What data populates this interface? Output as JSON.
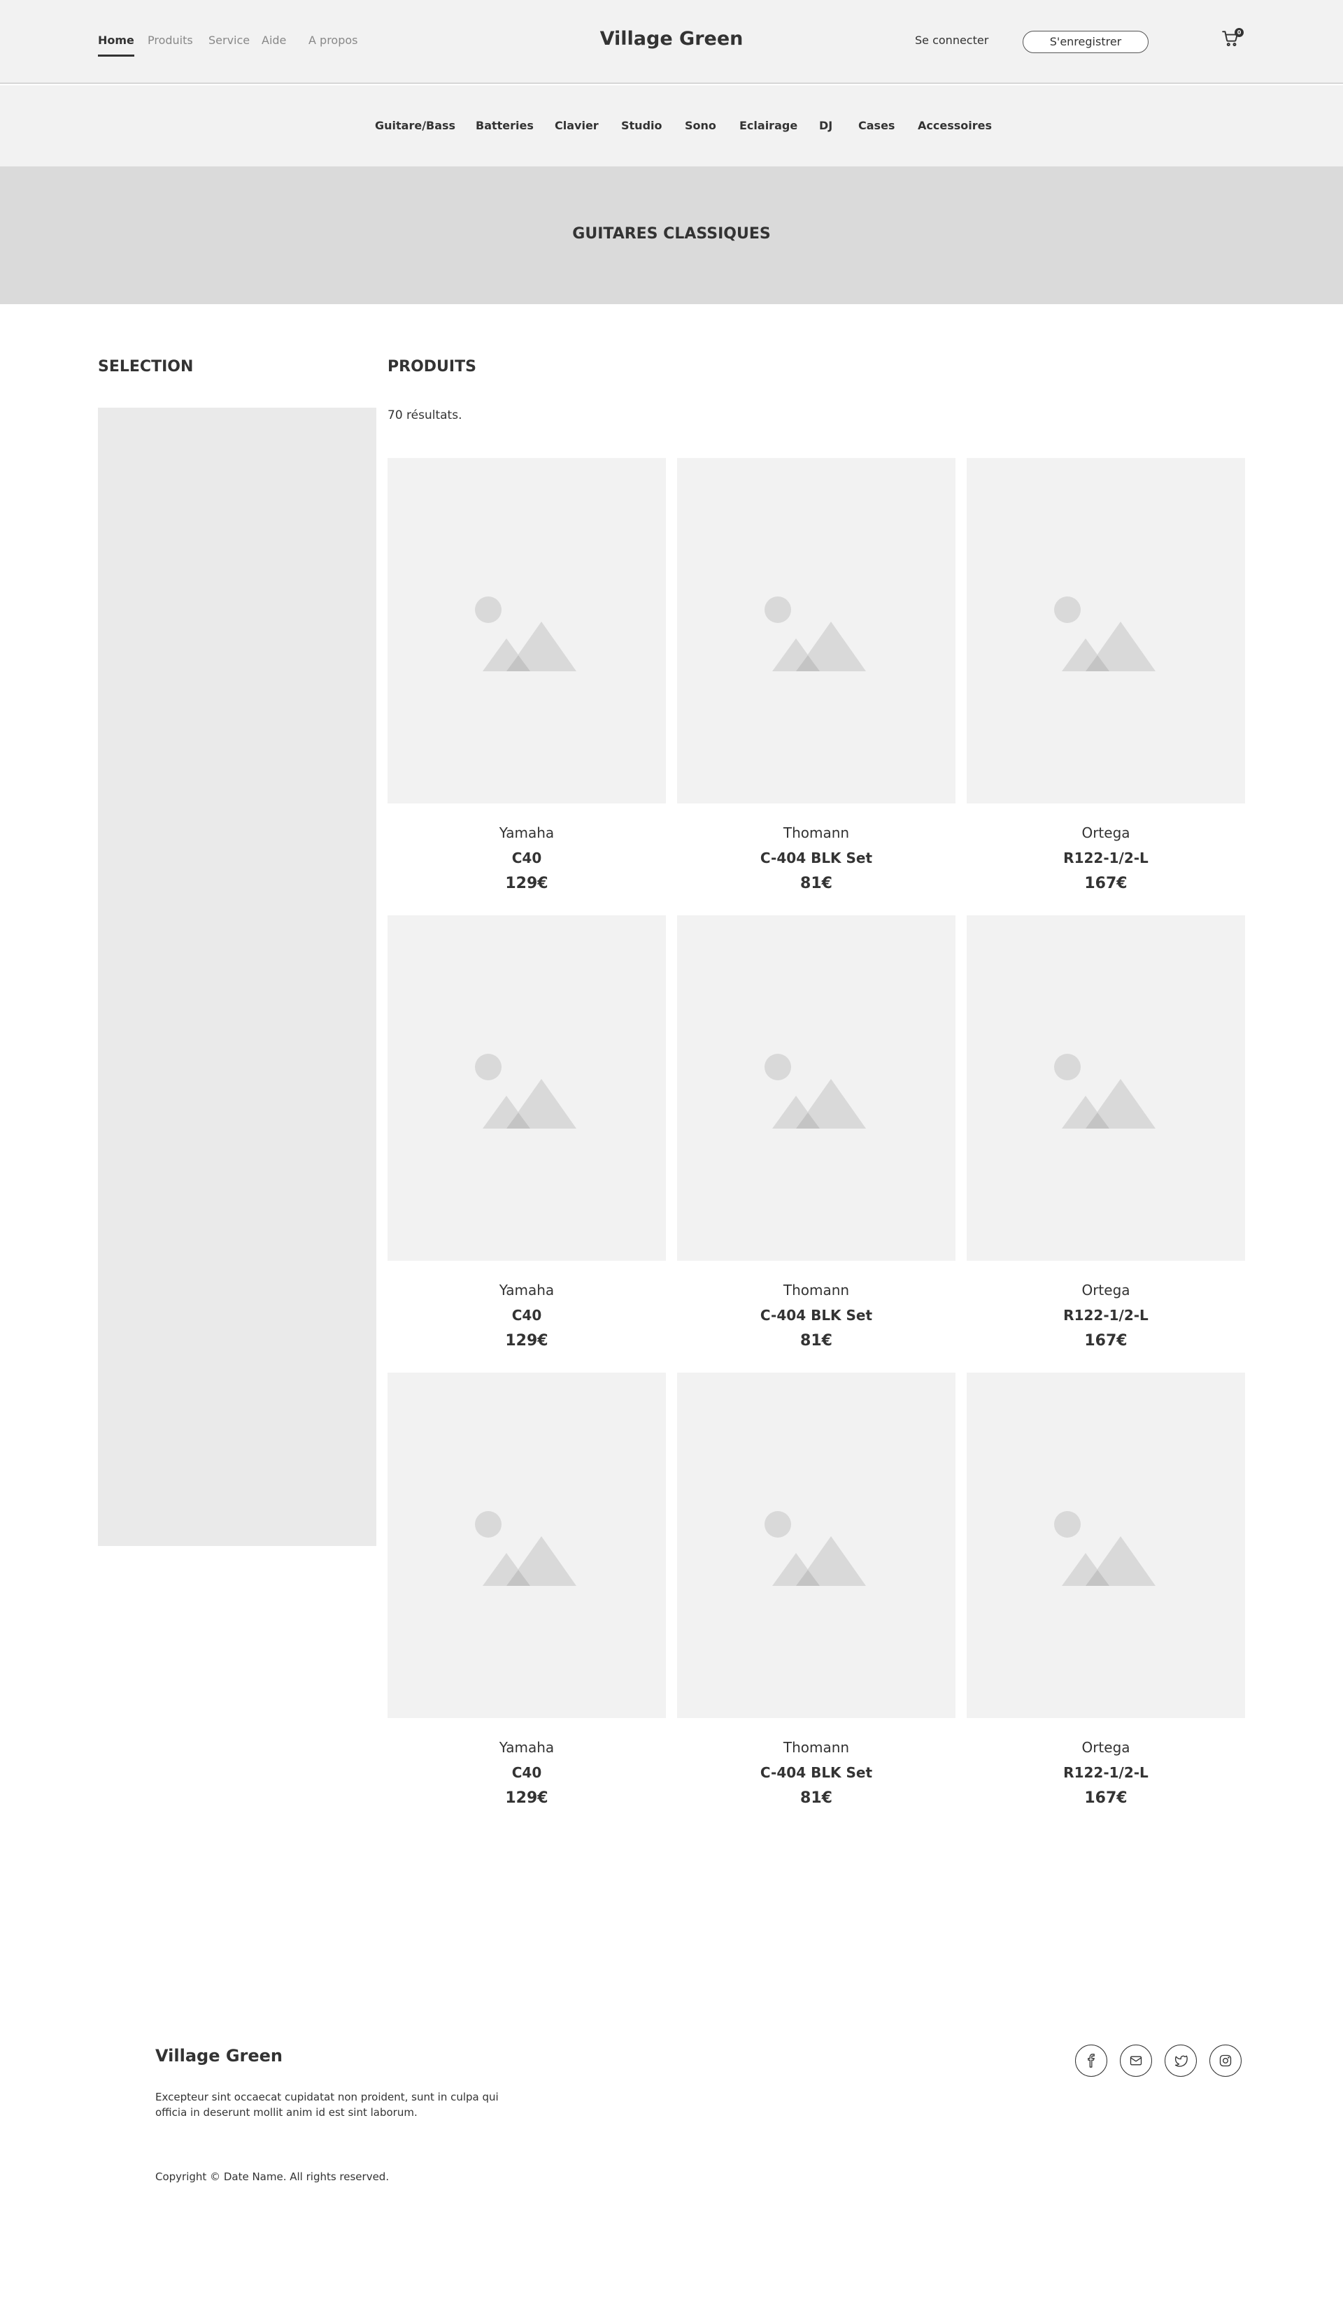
{
  "nav": {
    "links": [
      "Home",
      "Produits",
      "Service",
      "Aide",
      "A propos"
    ],
    "active": "Home"
  },
  "brand": "Village Green",
  "account": {
    "login_label": "Se connecter",
    "register_label": "S'enregistrer",
    "cart_count": "0"
  },
  "categories": [
    "Guitare/Bass",
    "Batteries",
    "Clavier",
    "Studio",
    "Sono",
    "Eclairage",
    "DJ",
    "Cases",
    "Accessoires"
  ],
  "hero": {
    "title": "GUITARES CLASSIQUES"
  },
  "sidebar": {
    "title": "SELECTION"
  },
  "products_section": {
    "title": "PRODUITS",
    "results": "70 résultats."
  },
  "products": [
    {
      "brand": "Yamaha",
      "model": "C40",
      "price": "129€"
    },
    {
      "brand": "Thomann",
      "model": "C-404 BLK Set",
      "price": "81€"
    },
    {
      "brand": "Ortega",
      "model": "R122-1/2-L",
      "price": "167€"
    },
    {
      "brand": "Yamaha",
      "model": "C40",
      "price": "129€"
    },
    {
      "brand": "Thomann",
      "model": "C-404 BLK Set",
      "price": "81€"
    },
    {
      "brand": "Ortega",
      "model": "R122-1/2-L",
      "price": "167€"
    },
    {
      "brand": "Yamaha",
      "model": "C40",
      "price": "129€"
    },
    {
      "brand": "Thomann",
      "model": "C-404 BLK Set",
      "price": "81€"
    },
    {
      "brand": "Ortega",
      "model": "R122-1/2-L",
      "price": "167€"
    }
  ],
  "footer": {
    "brand": "Village Green",
    "text": "Excepteur sint occaecat cupidatat non proident, sunt in culpa qui officia in deserunt mollit anim id est sint laborum.",
    "copyright": "Copyright © Date Name. All rights reserved.",
    "social_icons": [
      "facebook-icon",
      "mail-icon",
      "twitter-icon",
      "instagram-icon"
    ]
  },
  "colors": {
    "header_bg": "#f2f2f2",
    "hero_bg": "#dadada",
    "sidebar_bg": "#eaeaea",
    "text": "#333333",
    "muted": "#888888"
  }
}
